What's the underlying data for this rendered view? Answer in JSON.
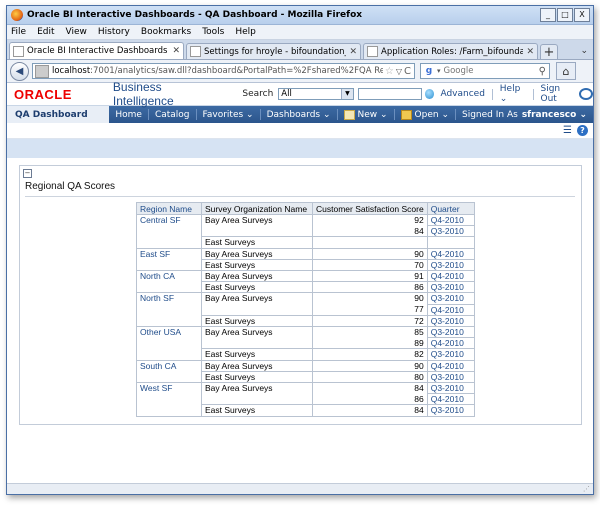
{
  "browser": {
    "title": "Oracle BI Interactive Dashboards - QA Dashboard - Mozilla Firefox",
    "window_buttons": [
      "_",
      "□",
      "X"
    ],
    "menu": [
      "File",
      "Edit",
      "View",
      "History",
      "Bookmarks",
      "Tools",
      "Help"
    ],
    "tabs": [
      {
        "label": "Oracle BI Interactive Dashboards - QA D...",
        "active": true
      },
      {
        "label": "Settings for hroyle - bifoundation_domai...",
        "active": false
      },
      {
        "label": "Application Roles: /Farm_bifoundation_d...",
        "active": false
      }
    ],
    "new_tab_label": "+",
    "url_host": "localhost",
    "url_rest": ":7001/analytics/saw.dll?dashboard&PortalPath=%2Fshared%2FQA Reports%2F_port",
    "search_placeholder": "Google"
  },
  "obi": {
    "brand": "ORACLE",
    "product": "Business Intelligence",
    "search_label": "Search",
    "search_scope": "All",
    "links": [
      "Advanced",
      "Help ⌄",
      "Sign Out"
    ],
    "dashboard_tab": "QA Dashboard",
    "nav": {
      "home": "Home",
      "catalog": "Catalog",
      "favorites": "Favorites ⌄",
      "dashboards": "Dashboards ⌄",
      "new": "New ⌄",
      "open": "Open ⌄",
      "signed_in_as": "Signed In As",
      "user": "sfrancesco ⌄"
    }
  },
  "report": {
    "title": "Regional QA Scores",
    "collapse_glyph": "−",
    "headers": [
      "Region Name",
      "Survey Organization Name",
      "Customer Satisfaction Score",
      "Quarter"
    ],
    "rows": [
      {
        "region": "Central SF",
        "org": "Bay Area Surveys",
        "score": "92",
        "quarter": "Q4-2010",
        "rsep": true,
        "osep": true
      },
      {
        "region": "",
        "org": "",
        "score": "84",
        "quarter": "Q3-2010",
        "rsep": false,
        "osep": false
      },
      {
        "region": "",
        "org": "East Surveys",
        "score": "",
        "quarter": "",
        "rsep": false,
        "osep": true,
        "hidden_score": true
      },
      {
        "region": "East SF",
        "org": "Bay Area Surveys",
        "score": "90",
        "quarter": "Q4-2010",
        "rsep": true,
        "osep": true
      },
      {
        "region": "",
        "org": "East Surveys",
        "score": "70",
        "quarter": "Q3-2010",
        "rsep": false,
        "osep": true
      },
      {
        "region": "North CA",
        "org": "Bay Area Surveys",
        "score": "91",
        "quarter": "Q4-2010",
        "rsep": true,
        "osep": true
      },
      {
        "region": "",
        "org": "East Surveys",
        "score": "86",
        "quarter": "Q3-2010",
        "rsep": false,
        "osep": true
      },
      {
        "region": "North SF",
        "org": "Bay Area Surveys",
        "score": "90",
        "quarter": "Q3-2010",
        "rsep": true,
        "osep": true
      },
      {
        "region": "",
        "org": "",
        "score": "77",
        "quarter": "Q4-2010",
        "rsep": false,
        "osep": false
      },
      {
        "region": "",
        "org": "East Surveys",
        "score": "72",
        "quarter": "Q3-2010",
        "rsep": false,
        "osep": true
      },
      {
        "region": "Other USA",
        "org": "Bay Area Surveys",
        "score": "85",
        "quarter": "Q3-2010",
        "rsep": true,
        "osep": true
      },
      {
        "region": "",
        "org": "",
        "score": "89",
        "quarter": "Q4-2010",
        "rsep": false,
        "osep": false
      },
      {
        "region": "",
        "org": "East Surveys",
        "score": "82",
        "quarter": "Q3-2010",
        "rsep": false,
        "osep": true
      },
      {
        "region": "South CA",
        "org": "Bay Area Surveys",
        "score": "90",
        "quarter": "Q4-2010",
        "rsep": true,
        "osep": true
      },
      {
        "region": "",
        "org": "East Surveys",
        "score": "80",
        "quarter": "Q3-2010",
        "rsep": false,
        "osep": true
      },
      {
        "region": "West SF",
        "org": "Bay Area Surveys",
        "score": "84",
        "quarter": "Q3-2010",
        "rsep": true,
        "osep": true
      },
      {
        "region": "",
        "org": "",
        "score": "86",
        "quarter": "Q4-2010",
        "rsep": false,
        "osep": false
      },
      {
        "region": "",
        "org": "East Surveys",
        "score": "84",
        "quarter": "Q3-2010",
        "rsep": false,
        "osep": true
      }
    ]
  },
  "colors": {
    "oracle_red": "#e00000",
    "obi_blue": "#2b558c",
    "link_blue": "#1f4c8a"
  }
}
